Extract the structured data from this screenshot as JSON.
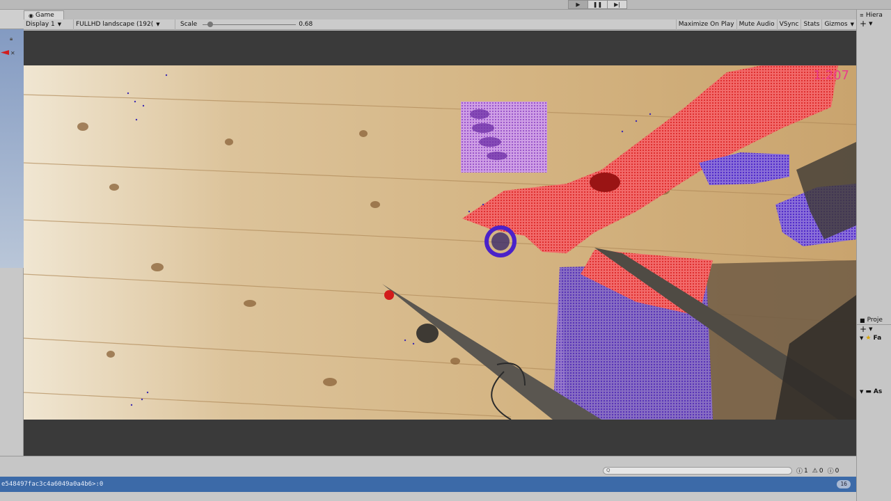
{
  "playbar": {
    "play": "▶",
    "pause": "❚❚",
    "step": "▶|"
  },
  "game_tab": {
    "label": "Game"
  },
  "toolbar": {
    "display": "Display 1",
    "resolution": "FULLHD landscape  (192(",
    "scale_label": "Scale",
    "scale_value": "0.68",
    "scale_fraction": 0.68,
    "maximize": "Maximize On Play",
    "mute": "Mute Audio",
    "vsync": "VSync",
    "stats": "Stats",
    "gizmos": "Gizmos"
  },
  "scene": {
    "fps_readout": "1.207"
  },
  "right_panel": {
    "hierarchy_title": "Hiera",
    "add_glyph": "+",
    "project_title": "Proje",
    "favorites": "Fa",
    "assets": "As"
  },
  "status": {
    "search_placeholder": "Q",
    "info_count": "1",
    "warn_count": "0",
    "error_count": "0"
  },
  "console": {
    "message": "e548497fac3c4a6049a0a4b6>:0",
    "badge": "16"
  },
  "colors": {
    "accent_blue": "#3c6aa8",
    "fps_pink": "#ea3c8b",
    "red_overlay": "#e62828",
    "blue_overlay": "#5a32dc"
  }
}
